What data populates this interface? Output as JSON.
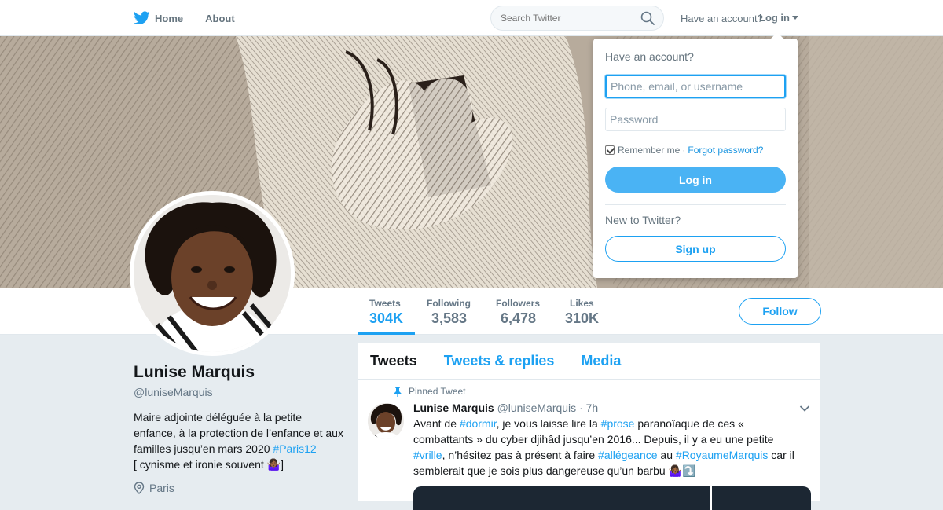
{
  "colors": {
    "accent": "#1da1f2",
    "link": "#1b95e0",
    "login_button": "#4ab3f4",
    "page_bg": "#e6ecf0"
  },
  "topbar": {
    "nav": [
      {
        "label": "Home",
        "icon": "twitter-bird-icon"
      },
      {
        "label": "About"
      }
    ],
    "search_placeholder": "Search Twitter",
    "search_icon": "search-icon",
    "have_account": "Have an account?",
    "login_label": "Log in"
  },
  "login_dropdown": {
    "title": "Have an account?",
    "username_placeholder": "Phone, email, or username",
    "password_placeholder": "Password",
    "remember_label": "Remember me",
    "separator": "·",
    "forgot_label": "Forgot password?",
    "login_button": "Log in",
    "new_label": "New to Twitter?",
    "signup_button": "Sign up"
  },
  "profile_nav": {
    "stats": [
      {
        "label": "Tweets",
        "value": "304K",
        "active": true
      },
      {
        "label": "Following",
        "value": "3,583"
      },
      {
        "label": "Followers",
        "value": "6,478"
      },
      {
        "label": "Likes",
        "value": "310K"
      }
    ],
    "follow_button": "Follow"
  },
  "profile": {
    "name": "Lunise Marquis",
    "handle": "@luniseMarquis",
    "bio_text": "Maire adjointe déléguée à la petite enfance, à la protection de l’enfance et aux familles jusqu’en mars 2020 ",
    "bio_hashtag": "#Paris12",
    "bio_line2": "[ cynisme et ironie souvent 🤷🏾‍♀️]",
    "location": "Paris"
  },
  "timeline": {
    "tabs": [
      "Tweets",
      "Tweets & replies",
      "Media"
    ],
    "pinned_label": "Pinned Tweet",
    "tweet": {
      "name": "Lunise Marquis",
      "handle": "@luniseMarquis",
      "time": "· 7h",
      "segments": [
        {
          "t": "Avant de "
        },
        {
          "t": "#dormir",
          "tag": true
        },
        {
          "t": ", je vous laisse lire la "
        },
        {
          "t": "#prose",
          "tag": true
        },
        {
          "t": " paranoïaque de ces « combattants » du cyber djihâd jusqu’en 2016... Depuis, il y a eu une petite "
        },
        {
          "t": "#vrille",
          "tag": true
        },
        {
          "t": ", n’hésitez pas à présent à faire "
        },
        {
          "t": "#allégeance",
          "tag": true
        },
        {
          "t": " au "
        },
        {
          "t": "#RoyaumeMarquis",
          "tag": true
        },
        {
          "t": " car il semblerait que je sois plus dangereuse qu’un barbu 🤷🏾‍♀️⤵️"
        }
      ]
    }
  }
}
